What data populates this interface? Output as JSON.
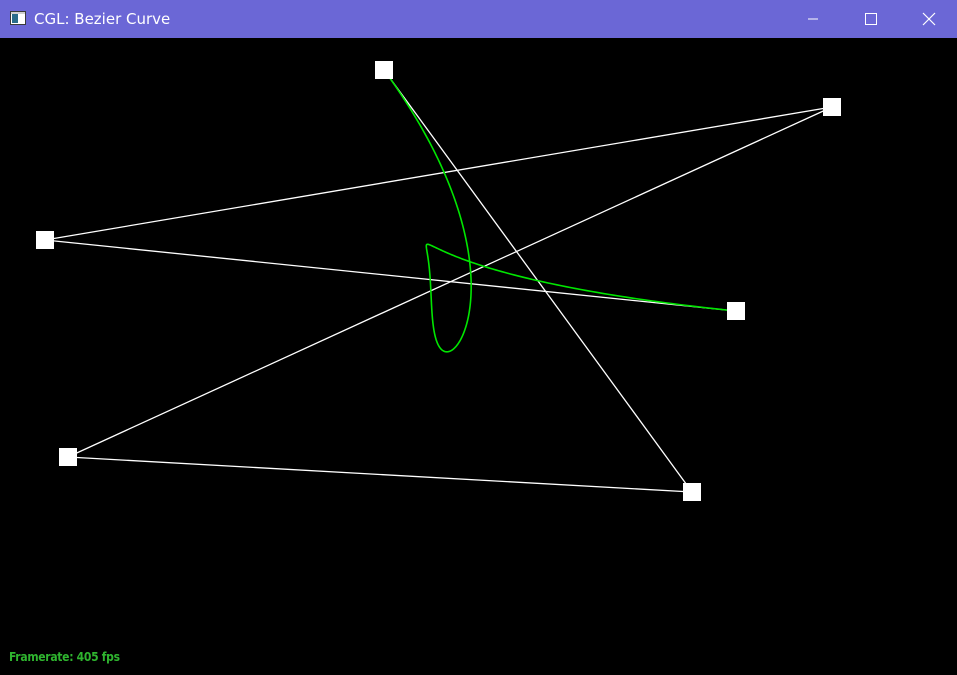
{
  "window": {
    "title": "CGL: Bezier Curve",
    "titlebar_color": "#6b67d6",
    "controls": {
      "minimize_icon": "minimize-icon",
      "maximize_icon": "maximize-icon",
      "close_icon": "close-icon"
    }
  },
  "scene": {
    "background_color": "#000000",
    "control_polygon_color": "#ffffff",
    "curve_color": "#00e600",
    "control_point_count": 6
  },
  "status": {
    "framerate_text": "Framerate: 405 fps",
    "framerate_color": "#2fb52f"
  }
}
